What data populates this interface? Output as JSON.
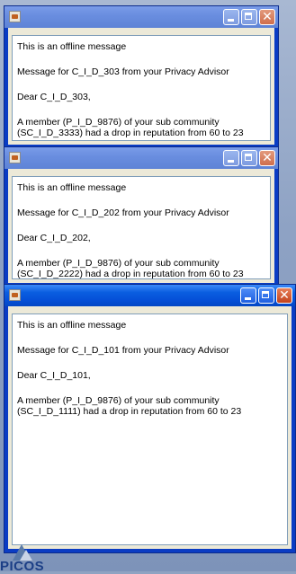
{
  "windows": [
    {
      "lines": [
        "This is an offline message",
        "Message for C_I_D_303 from your Privacy Advisor",
        "Dear C_I_D_303,",
        "A member (P_I_D_9876) of your sub community (SC_I_D_3333) had a drop in reputation from 60 to 23"
      ],
      "active": false
    },
    {
      "lines": [
        "This is an offline message",
        "Message for C_I_D_202 from your Privacy Advisor",
        "Dear C_I_D_202,",
        "A member (P_I_D_9876) of your sub community (SC_I_D_2222) had a drop in reputation from 60 to 23"
      ],
      "active": false
    },
    {
      "lines": [
        "This is an offline message",
        "Message for C_I_D_101 from your Privacy Advisor",
        "Dear C_I_D_101,",
        "A member (P_I_D_9876) of your sub community (SC_I_D_1111) had a drop in reputation from 60 to 23"
      ],
      "active": true
    }
  ],
  "logo": {
    "text": "PICOS"
  },
  "icons": {
    "app": "java-app-icon",
    "minimize": "minimize-icon",
    "maximize": "maximize-icon",
    "close": "close-icon"
  }
}
